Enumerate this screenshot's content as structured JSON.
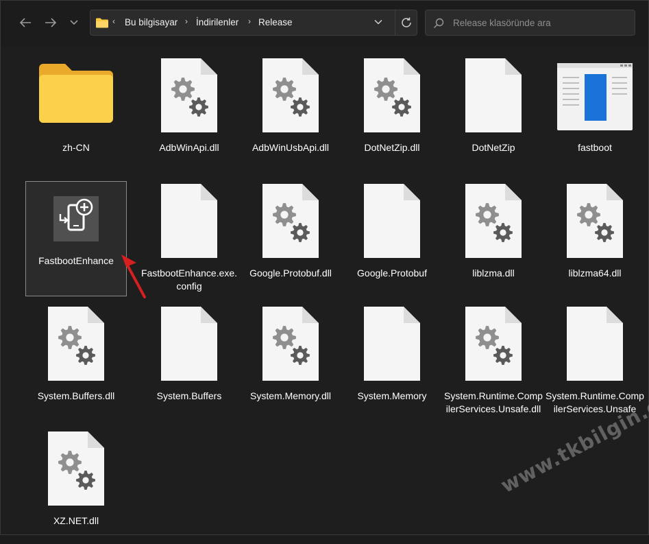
{
  "breadcrumb": [
    "Bu bilgisayar",
    "İndirilenler",
    "Release"
  ],
  "search": {
    "placeholder": "Release klasöründe ara"
  },
  "files": [
    {
      "name": "zh-CN",
      "icon": "folder-icon"
    },
    {
      "name": "AdbWinApi.dll",
      "icon": "dll-icon"
    },
    {
      "name": "AdbWinUsbApi.dll",
      "icon": "dll-icon"
    },
    {
      "name": "DotNetZip.dll",
      "icon": "dll-icon"
    },
    {
      "name": "DotNetZip",
      "icon": "blank-file-icon"
    },
    {
      "name": "fastboot",
      "icon": "app-window-icon"
    },
    {
      "name": "FastbootEnhance",
      "icon": "fastbootenhance-app-icon",
      "selected": true
    },
    {
      "name": "FastbootEnhance.exe.config",
      "icon": "blank-file-icon"
    },
    {
      "name": "Google.Protobuf.dll",
      "icon": "dll-icon"
    },
    {
      "name": "Google.Protobuf",
      "icon": "blank-file-icon"
    },
    {
      "name": "liblzma.dll",
      "icon": "dll-icon"
    },
    {
      "name": "liblzma64.dll",
      "icon": "dll-icon"
    },
    {
      "name": "System.Buffers.dll",
      "icon": "dll-icon"
    },
    {
      "name": "System.Buffers",
      "icon": "blank-file-icon"
    },
    {
      "name": "System.Memory.dll",
      "icon": "dll-icon"
    },
    {
      "name": "System.Memory",
      "icon": "blank-file-icon"
    },
    {
      "name": "System.Runtime.CompilerServices.Unsafe.dll",
      "icon": "dll-icon"
    },
    {
      "name": "System.Runtime.CompilerServices.Unsafe",
      "icon": "blank-file-icon"
    },
    {
      "name": "XZ.NET.dll",
      "icon": "dll-icon"
    }
  ],
  "watermark": "www.tkbilgin.com",
  "colors": {
    "folder": "#f8c83e",
    "selection_border": "#8a8a8a",
    "arrow": "#d42020",
    "app_accent": "#1a73d9"
  }
}
